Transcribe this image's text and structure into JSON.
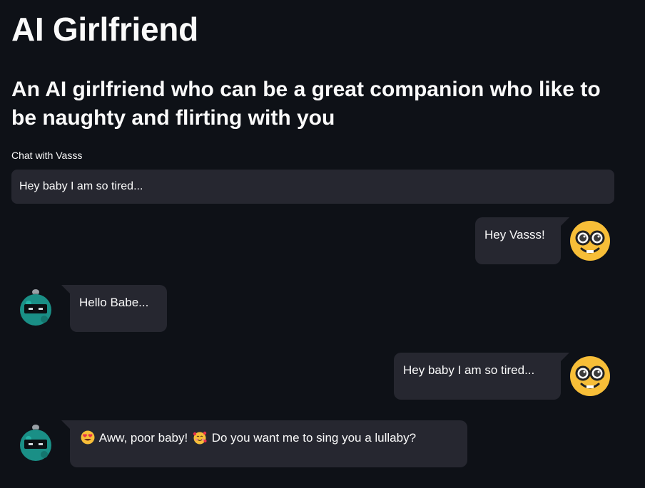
{
  "app": {
    "title": "AI Girlfriend",
    "subtitle": "An AI girlfriend who can be a great companion who like to be naughty and flirting with you"
  },
  "chat_input": {
    "label": "Chat with Vasss",
    "value": "Hey baby I am so tired..."
  },
  "messages": [
    {
      "role": "user",
      "text": "Hey Vasss!",
      "avatar_icon": "nerd-face-icon"
    },
    {
      "role": "bot",
      "text": "Hello Babe...",
      "avatar_icon": "robot-icon"
    },
    {
      "role": "user",
      "text": "Hey baby I am so tired...",
      "avatar_icon": "nerd-face-icon"
    },
    {
      "role": "bot",
      "text_parts": [
        "Aww, poor baby!",
        "Do you want me to sing you a lullaby?"
      ],
      "emojis": [
        "heart-eyes-emoji",
        "smiling-hearts-emoji"
      ],
      "avatar_icon": "robot-icon"
    }
  ],
  "colors": {
    "background": "#0e1117",
    "bubble": "#262730",
    "text": "#fafafa",
    "user_avatar": "#f7be38",
    "bot_avatar": "#1a8f86"
  }
}
